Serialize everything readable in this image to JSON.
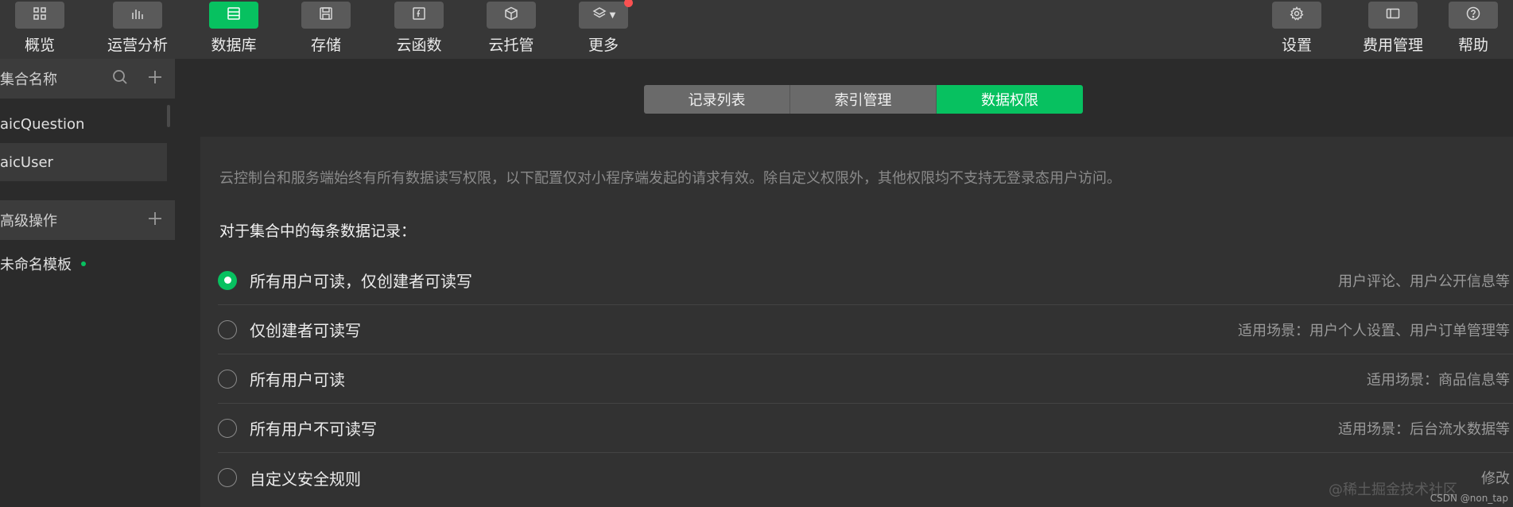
{
  "toolbar": {
    "left": [
      {
        "label": "概览",
        "icon": "grid-icon"
      },
      {
        "label": "运营分析",
        "icon": "bar-chart-icon"
      },
      {
        "label": "数据库",
        "icon": "database-icon"
      },
      {
        "label": "存储",
        "icon": "floppy-icon"
      },
      {
        "label": "云函数",
        "icon": "function-icon"
      },
      {
        "label": "云托管",
        "icon": "cube-icon"
      },
      {
        "label": "更多",
        "icon": "layers-icon"
      }
    ],
    "right": [
      {
        "label": "设置",
        "icon": "gear-icon"
      },
      {
        "label": "费用管理",
        "icon": "card-icon"
      },
      {
        "label": "帮助",
        "icon": "help-icon"
      }
    ],
    "active_index": 2,
    "accent": "#07c160",
    "notify_color": "#fa5151"
  },
  "sidebar": {
    "collections_title": "集合名称",
    "collections": [
      {
        "name": "aicQuestion"
      },
      {
        "name": "aicUser"
      }
    ],
    "advanced_title": "高级操作",
    "templates": [
      {
        "name": "未命名模板"
      }
    ]
  },
  "main": {
    "tabs": [
      "记录列表",
      "索引管理",
      "数据权限"
    ],
    "active_tab": 2,
    "notice": "云控制台和服务端始终有所有数据读写权限，以下配置仅对小程序端发起的请求有效。除自定义权限外，其他权限均不支持无登录态用户访问。",
    "subheading": "对于集合中的每条数据记录：",
    "options": [
      {
        "label": "所有用户可读，仅创建者可读写",
        "desc": "用户评论、用户公开信息等",
        "checked": true
      },
      {
        "label": "仅创建者可读写",
        "desc": "适用场景：用户个人设置、用户订单管理等",
        "checked": false
      },
      {
        "label": "所有用户可读",
        "desc": "适用场景：商品信息等",
        "checked": false
      },
      {
        "label": "所有用户不可读写",
        "desc": "适用场景：后台流水数据等",
        "checked": false
      },
      {
        "label": "自定义安全规则",
        "desc": "修改",
        "checked": false
      }
    ]
  },
  "watermark": "CSDN @non_tap",
  "watermark_overlay": "@稀土掘金技术社区"
}
